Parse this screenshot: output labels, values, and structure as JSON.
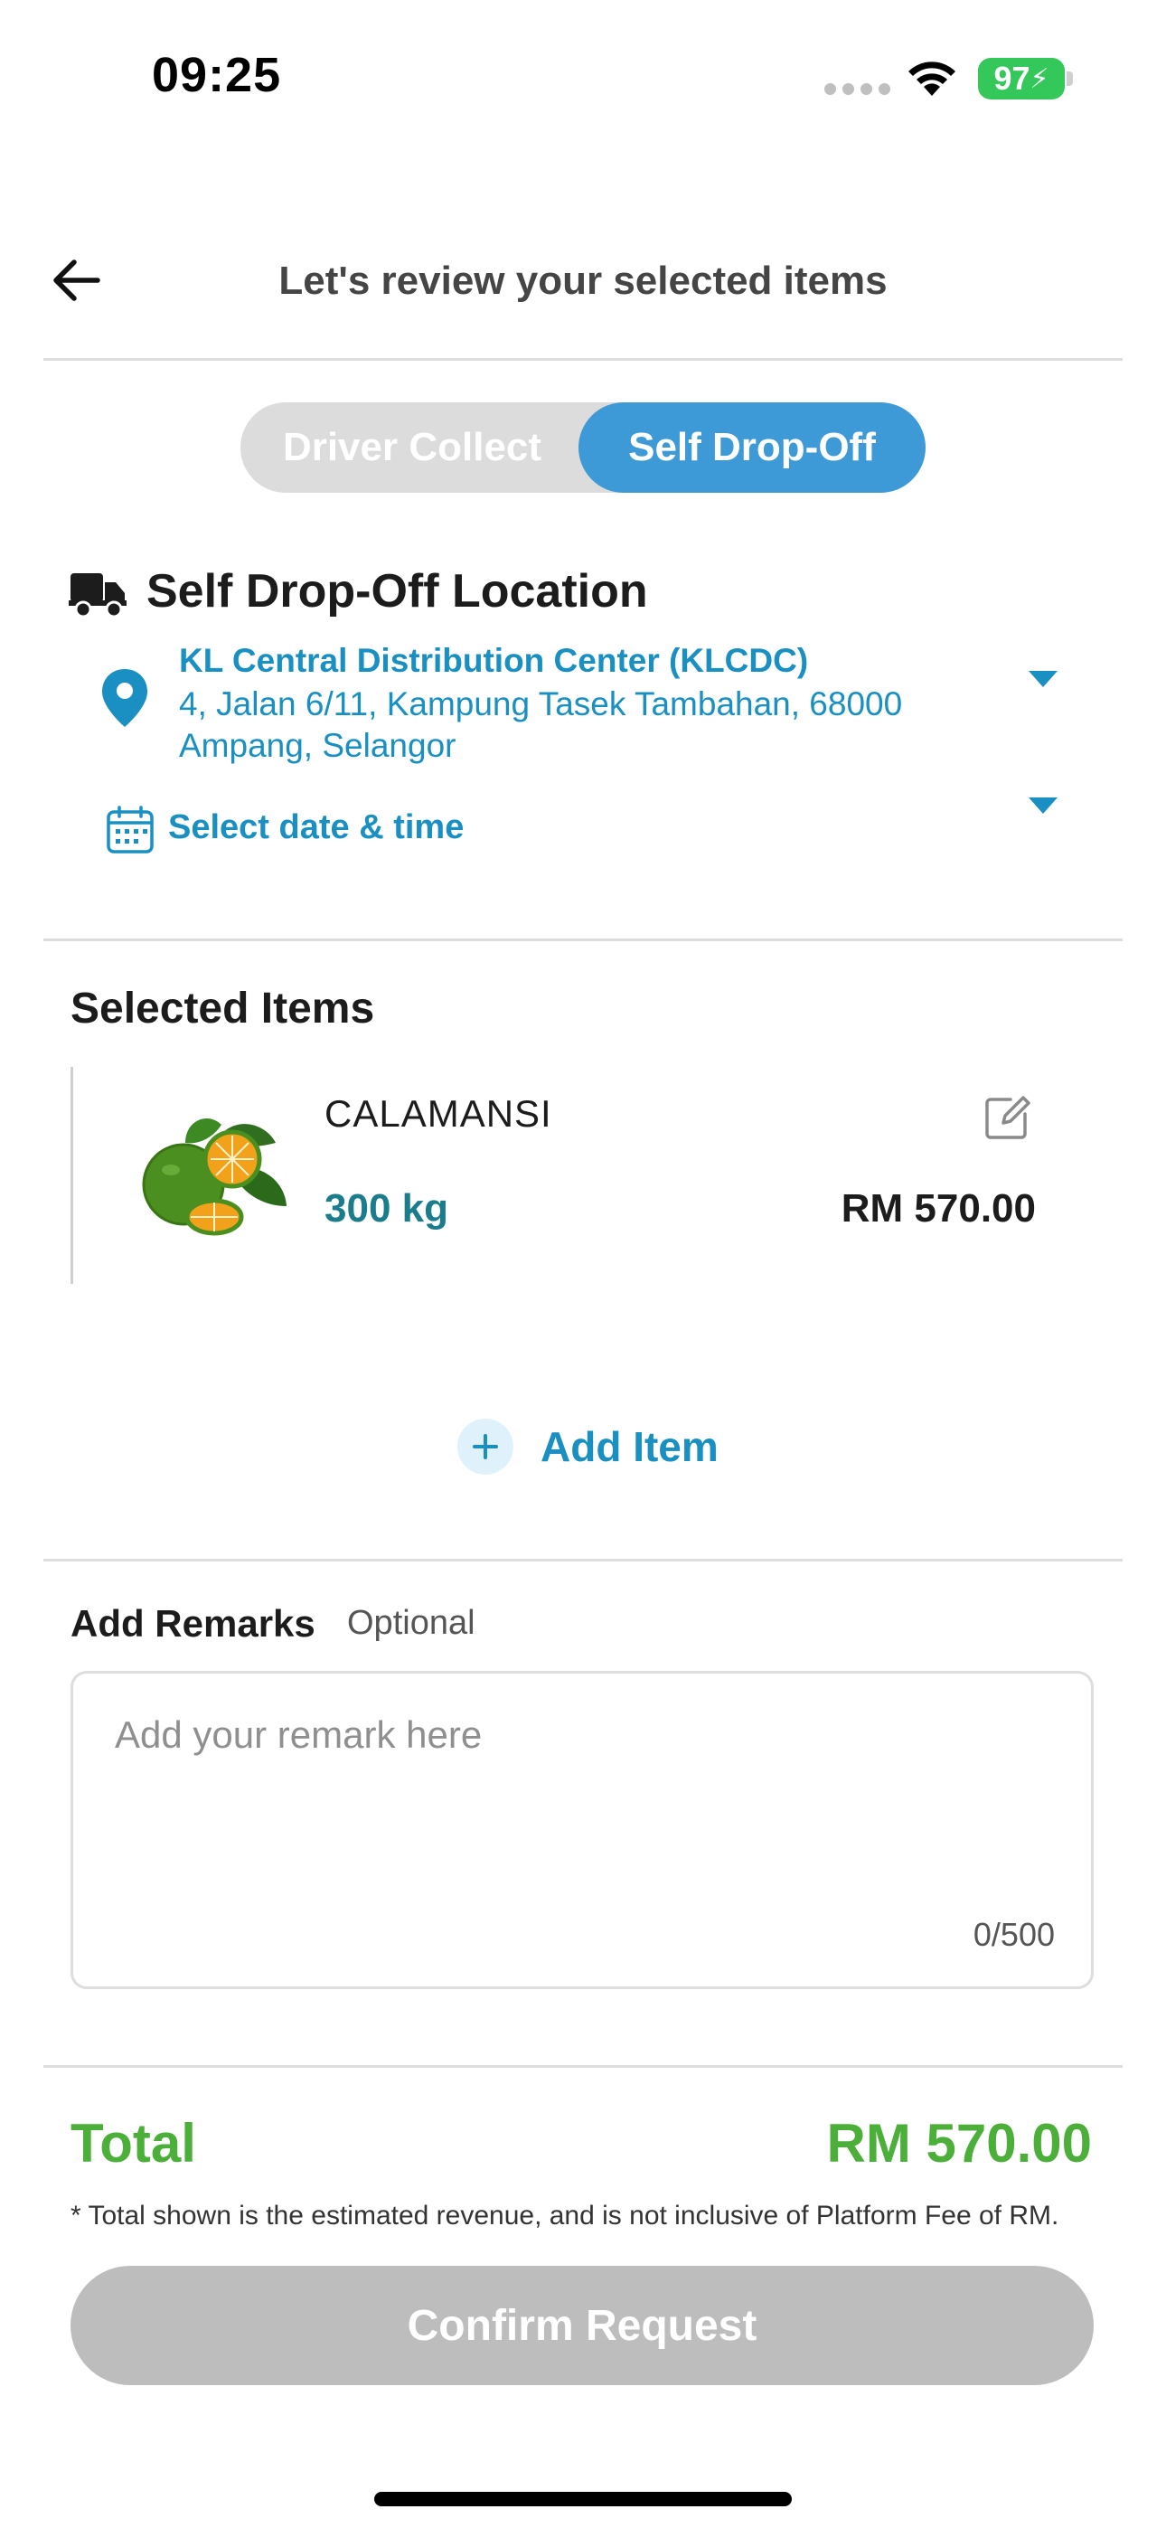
{
  "status_bar": {
    "time": "09:25",
    "battery": "97"
  },
  "header": {
    "title": "Let's review your selected items"
  },
  "toggle": {
    "left_label": "Driver Collect",
    "right_label": "Self Drop-Off",
    "selected": "Self Drop-Off"
  },
  "location": {
    "section_title": "Self Drop-Off Location",
    "name": "KL Central Distribution Center (KLCDC)",
    "address_line1": "4, Jalan 6/11, Kampung Tasek Tambahan, 68000",
    "address_line2": "Ampang, Selangor",
    "date_label": "Select date & time"
  },
  "items": {
    "section_title": "Selected Items",
    "list": [
      {
        "name": "CALAMANSI",
        "quantity": "300 kg",
        "price": "RM 570.00"
      }
    ],
    "add_label": "Add Item"
  },
  "remarks": {
    "title": "Add Remarks",
    "optional": "Optional",
    "placeholder": "Add your remark here",
    "counter": "0/500"
  },
  "total": {
    "label": "Total",
    "value": "RM 570.00",
    "note": "* Total shown is the estimated revenue, and is not inclusive of Platform Fee of RM."
  },
  "confirm_label": "Confirm Request",
  "colors": {
    "accent": "#1a8fc2",
    "toggle_active": "#3d9ad6",
    "total_green": "#4caf3a",
    "qty_teal": "#1b7c8c",
    "disabled_button": "#bdbdbd"
  }
}
